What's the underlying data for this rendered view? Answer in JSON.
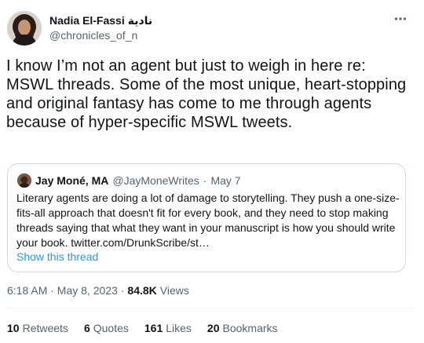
{
  "author": {
    "name": "Nadia El-Fassi",
    "name_arabic": "نادية",
    "handle": "@chronicles_of_n"
  },
  "tweet": {
    "text": "I know I’m not an agent but just to weigh in here re: MSWL threads. Some of the most unique, heart-stopping and original fantasy has come to me through agents because of hyper-specific MSWL tweets."
  },
  "quote": {
    "name": "Jay Moné, MA",
    "handle": "@JayMoneWrites",
    "separator": "·",
    "date": "May 7",
    "text": "Literary agents are doing a lot of damage to storytelling. They push a one-size-fits-all approach that doesn't fit for every book, and they need to stop making threads saying that what they want in your manuscript is how you should write your book. twitter.com/DrunkScribe/st…",
    "show_thread": "Show this thread"
  },
  "meta": {
    "time_date": "6:18 AM · May 8, 2023 ·",
    "views_count": "84.8K",
    "views_label": "Views"
  },
  "stats": [
    {
      "count": "10",
      "label": "Retweets"
    },
    {
      "count": "6",
      "label": "Quotes"
    },
    {
      "count": "161",
      "label": "Likes"
    },
    {
      "count": "20",
      "label": "Bookmarks"
    }
  ],
  "icons": {
    "more": "more-horizontal-icon"
  },
  "colors": {
    "link": "#1d9bf0",
    "secondary_text": "#536471",
    "border": "#cfd9de"
  }
}
